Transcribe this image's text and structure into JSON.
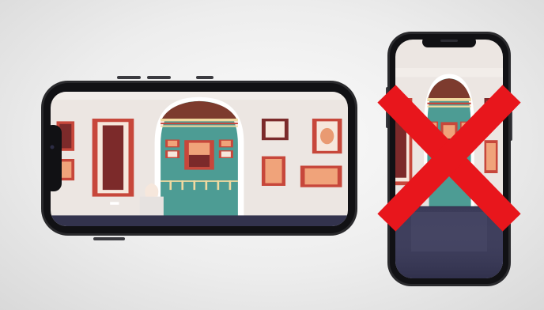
{
  "scene": {
    "caption": "",
    "landscape_phone": {
      "orientation": "landscape",
      "status": "recommended"
    },
    "portrait_phone": {
      "orientation": "portrait",
      "status": "not-recommended"
    }
  },
  "colors": {
    "background": "#e9e9e9",
    "phone_frame": "#2a2a2d",
    "wall": "#e7e0dc",
    "frame_red": "#c7473b",
    "frame_orange": "#e99a72",
    "painting_dark": "#7c2a2a",
    "alcove_teal": "#4d9c94",
    "floor_navy": "#33334d",
    "cross_red": "#e8161c"
  },
  "icons": {
    "cross": "cross-mark-icon"
  }
}
